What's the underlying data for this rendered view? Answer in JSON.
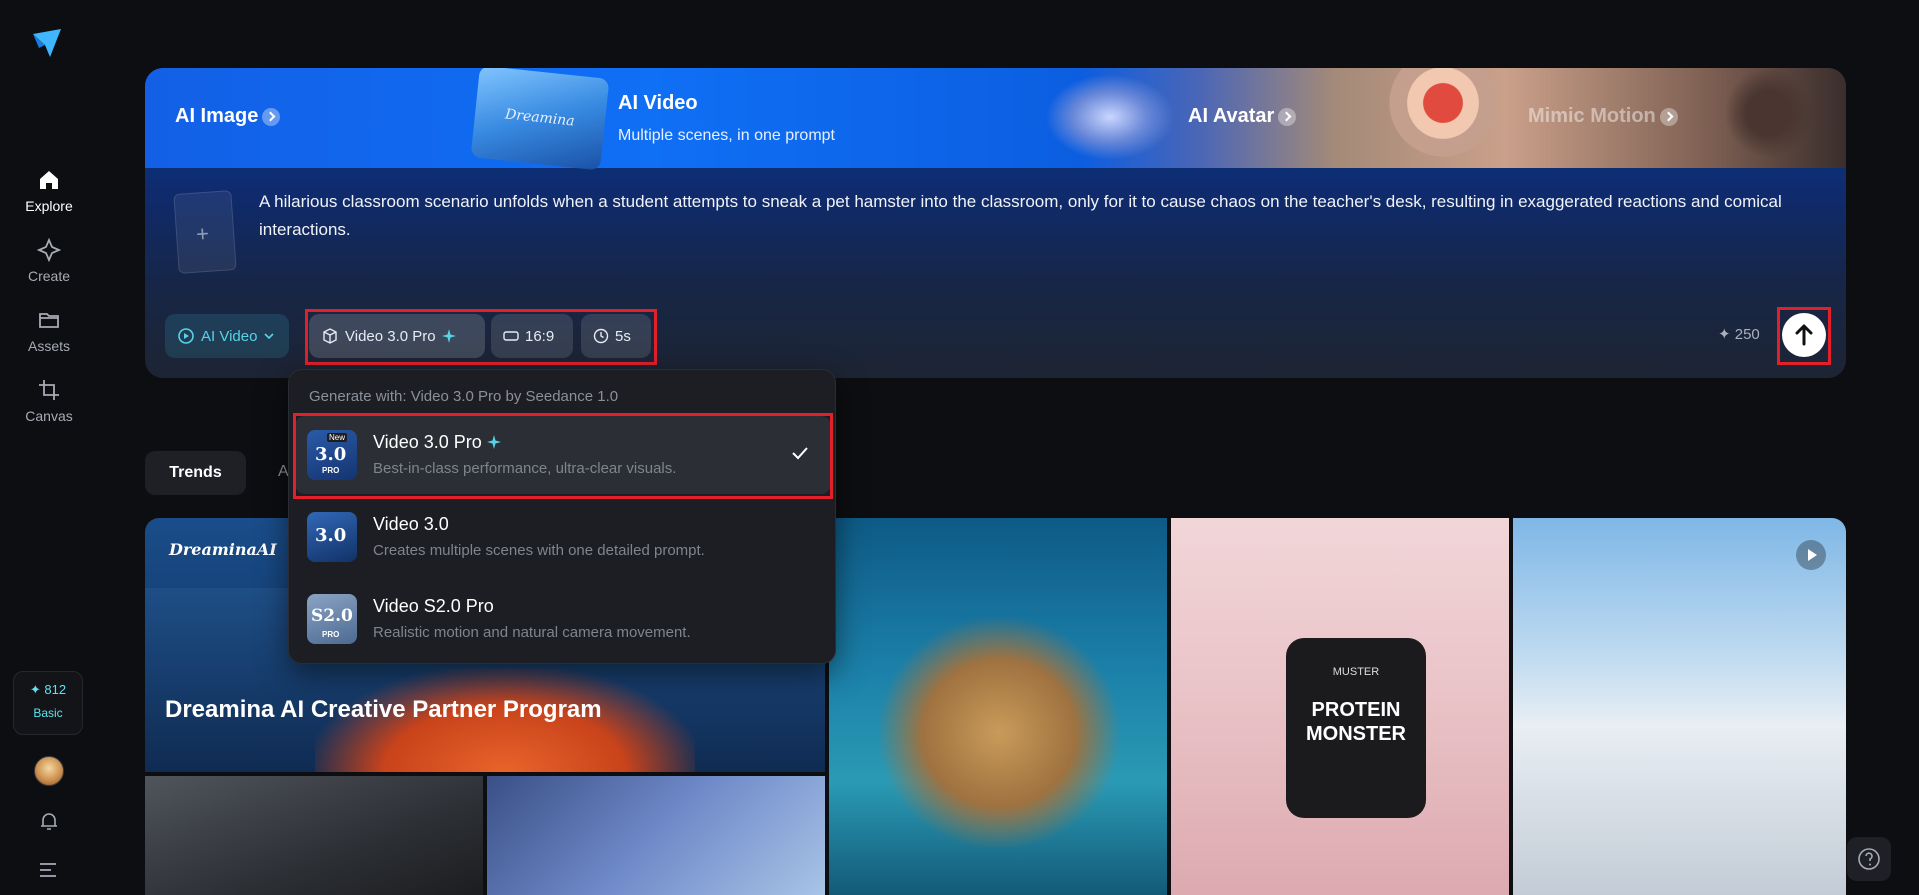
{
  "sidebar": {
    "items": [
      {
        "label": "Explore",
        "icon": "home-icon"
      },
      {
        "label": "Create",
        "icon": "sparkle-icon"
      },
      {
        "label": "Assets",
        "icon": "folder-icon"
      },
      {
        "label": "Canvas",
        "icon": "crop-icon"
      }
    ],
    "credits": {
      "value": "✦ 812",
      "plan": "Basic"
    }
  },
  "hero": {
    "tabs": [
      {
        "label": "AI Image"
      },
      {
        "label": "AI Video",
        "subtitle": "Multiple scenes, in one prompt"
      },
      {
        "label": "AI Avatar"
      },
      {
        "label": "Mimic Motion"
      }
    ],
    "thumb_text": "Dreamina",
    "prompt": "A hilarious classroom scenario unfolds when a student attempts to sneak a pet hamster into the classroom, only for it to cause chaos on the teacher's desk, resulting in exaggerated reactions and comical interactions.",
    "upload_plus": "+",
    "controls": {
      "mode": "AI Video",
      "model": "Video 3.0 Pro",
      "ratio": "16:9",
      "duration": "5s",
      "cost": "250"
    }
  },
  "dropdown": {
    "header": "Generate with: Video 3.0 Pro by Seedance 1.0",
    "items": [
      {
        "title": "Video 3.0 Pro",
        "desc": "Best-in-class performance, ultra-clear visuals.",
        "badge": "3.0",
        "tag": "PRO",
        "new": "New",
        "selected": true
      },
      {
        "title": "Video 3.0",
        "desc": "Creates multiple scenes with one detailed prompt.",
        "badge": "3.0"
      },
      {
        "title": "Video S2.0 Pro",
        "desc": "Realistic motion and natural camera movement.",
        "badge": "S2.0",
        "tag": "PRO"
      }
    ]
  },
  "feed": {
    "tabs": [
      "Trends",
      "A"
    ],
    "banner_logo": "DreaminaAI",
    "banner_title": "Dreamina AI Creative Partner Program",
    "jar_text_1": "PROTEIN",
    "jar_text_2": "MONSTER",
    "jar_brand": "MUSTER"
  },
  "colors": {
    "accent_cyan": "#56d4e6",
    "highlight_red": "#e3202a",
    "background": "#0d0e11"
  }
}
